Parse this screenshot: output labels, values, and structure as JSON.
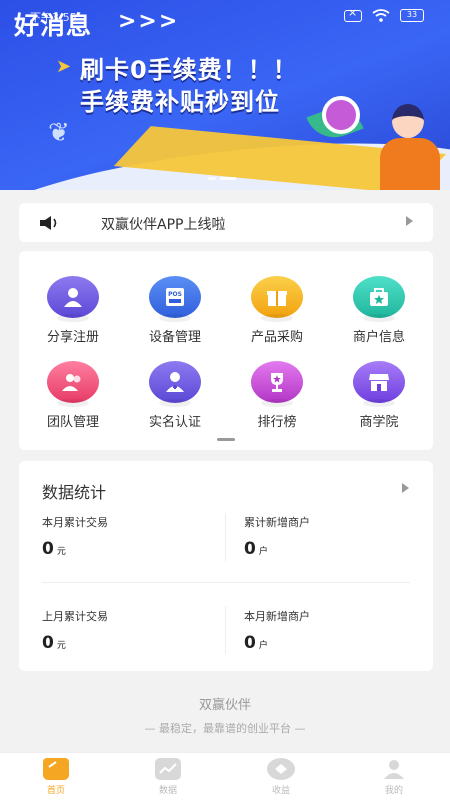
{
  "status_bar": {
    "time": "下午3:55"
  },
  "banner": {
    "headline": "好消息",
    "arrows": ">>>",
    "line1": "刷卡0手续费！！！",
    "line2": "手续费补贴秒到位"
  },
  "notice": {
    "text": "双赢伙伴APP上线啦"
  },
  "menu": {
    "items": [
      {
        "label": "分享注册",
        "icon": "share-register-icon",
        "color": "#6b5ae0"
      },
      {
        "label": "设备管理",
        "icon": "pos-device-icon",
        "color": "#3d73e8"
      },
      {
        "label": "产品采购",
        "icon": "gift-icon",
        "color": "#f5b21d"
      },
      {
        "label": "商户信息",
        "icon": "merchant-info-icon",
        "color": "#2fc9b4"
      },
      {
        "label": "团队管理",
        "icon": "team-icon",
        "color": "#f0507a"
      },
      {
        "label": "实名认证",
        "icon": "verify-user-icon",
        "color": "#6b5ae0"
      },
      {
        "label": "排行榜",
        "icon": "trophy-icon",
        "color": "#c94ad6"
      },
      {
        "label": "商学院",
        "icon": "store-icon",
        "color": "#8a5cf0"
      }
    ]
  },
  "stats": {
    "title": "数据统计",
    "items": [
      {
        "label": "本月累计交易",
        "value": "0",
        "unit": "元"
      },
      {
        "label": "累计新增商户",
        "value": "0",
        "unit": "户"
      },
      {
        "label": "上月累计交易",
        "value": "0",
        "unit": "元"
      },
      {
        "label": "本月新增商户",
        "value": "0",
        "unit": "户"
      }
    ]
  },
  "brand": {
    "name": "双赢伙伴",
    "slogan": "—   最稳定，最靠谱的创业平台   —"
  },
  "tabbar": {
    "items": [
      {
        "label": "首页",
        "icon": "home-icon",
        "active": true
      },
      {
        "label": "数据",
        "icon": "chart-icon",
        "active": false
      },
      {
        "label": "收益",
        "icon": "earnings-icon",
        "active": false
      },
      {
        "label": "我的",
        "icon": "profile-icon",
        "active": false
      }
    ]
  },
  "colors": {
    "accent": "#f5a623",
    "banner_blue": "#3a66f5"
  }
}
